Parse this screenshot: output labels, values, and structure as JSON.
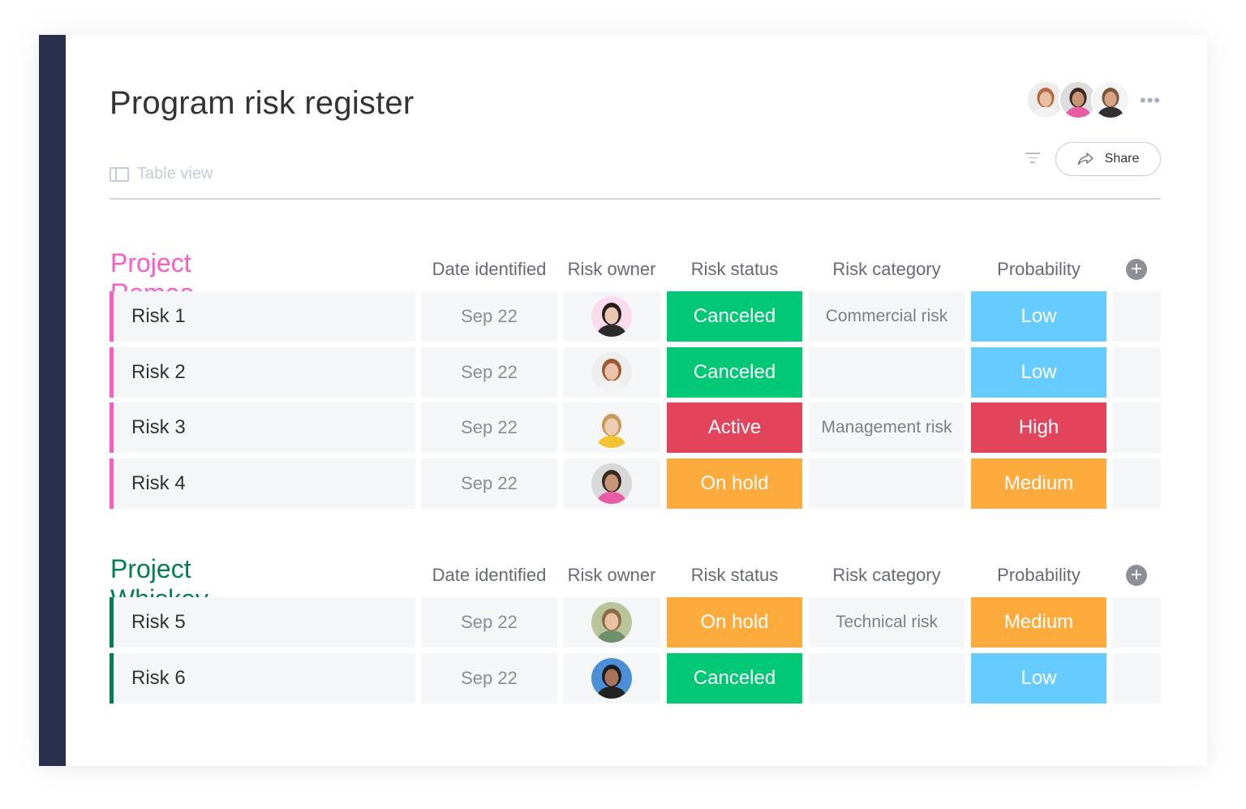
{
  "board": {
    "title": "Program risk register",
    "view_tab": "Table view",
    "share_label": "Share",
    "more_label": "•••",
    "members": [
      {
        "name": "member-1",
        "skin": "#e8c0a6",
        "hair": "#b86a3e",
        "shirt": "#f2f2f2",
        "bg": "#ececec"
      },
      {
        "name": "member-2",
        "skin": "#c99577",
        "hair": "#3b2a22",
        "shirt": "#e85ca6",
        "bg": "#dddddd"
      },
      {
        "name": "member-3",
        "skin": "#d7a384",
        "hair": "#7a5a3c",
        "shirt": "#303030",
        "bg": "#f4f4f4"
      }
    ]
  },
  "colors": {
    "sidebar": "#292f4c",
    "status_canceled": "#00c875",
    "status_active": "#e2445c",
    "status_onhold": "#fdab3d",
    "prob_low": "#66ccff",
    "prob_high": "#e2445c",
    "prob_medium": "#fdab3d",
    "romeo": "#ff5ac4",
    "whiskey": "#037f4c"
  },
  "columns": [
    "Date identified",
    "Risk owner",
    "Risk status",
    "Risk category",
    "Probability"
  ],
  "groups": [
    {
      "title": "Project Romeo",
      "color": "#ff5ac4",
      "rows": [
        {
          "name": "Risk 1",
          "date": "Sep 22",
          "owner": {
            "skin": "#e9c6b2",
            "hair": "#2a1e1a",
            "shirt": "#2b2b2b",
            "bg": "#fbdcef"
          },
          "status": "Canceled",
          "status_color": "#00c875",
          "category": "Commercial risk",
          "probability": "Low",
          "prob_color": "#66ccff"
        },
        {
          "name": "Risk 2",
          "date": "Sep 22",
          "owner": {
            "skin": "#ecc3a8",
            "hair": "#9c5a34",
            "shirt": "#f3f3f3",
            "bg": "#eeeeee"
          },
          "status": "Canceled",
          "status_color": "#00c875",
          "category": "",
          "probability": "Low",
          "prob_color": "#66ccff"
        },
        {
          "name": "Risk 3",
          "date": "Sep 22",
          "owner": {
            "skin": "#efcdb3",
            "hair": "#c79a5c",
            "shirt": "#f2c230",
            "bg": "#f6f6f6"
          },
          "status": "Active",
          "status_color": "#e2445c",
          "category": "Management risk",
          "probability": "High",
          "prob_color": "#e2445c"
        },
        {
          "name": "Risk 4",
          "date": "Sep 22",
          "owner": {
            "skin": "#c99577",
            "hair": "#3b2a22",
            "shirt": "#e85ca6",
            "bg": "#d8d8d8"
          },
          "status": "On hold",
          "status_color": "#fdab3d",
          "category": "",
          "probability": "Medium",
          "prob_color": "#fdab3d"
        }
      ]
    },
    {
      "title": "Project Whiskey",
      "color": "#037f4c",
      "rows": [
        {
          "name": "Risk 5",
          "date": "Sep 22",
          "owner": {
            "skin": "#eac1a0",
            "hair": "#8d6a45",
            "shirt": "#6d8f6a",
            "bg": "#b8c49a"
          },
          "status": "On hold",
          "status_color": "#fdab3d",
          "category": "Technical risk",
          "probability": "Medium",
          "prob_color": "#fdab3d"
        },
        {
          "name": "Risk 6",
          "date": "Sep 22",
          "owner": {
            "skin": "#a8735a",
            "hair": "#1d1d1d",
            "shirt": "#222222",
            "bg": "#4a8fd8"
          },
          "status": "Canceled",
          "status_color": "#00c875",
          "category": "",
          "probability": "Low",
          "prob_color": "#66ccff"
        }
      ]
    }
  ]
}
